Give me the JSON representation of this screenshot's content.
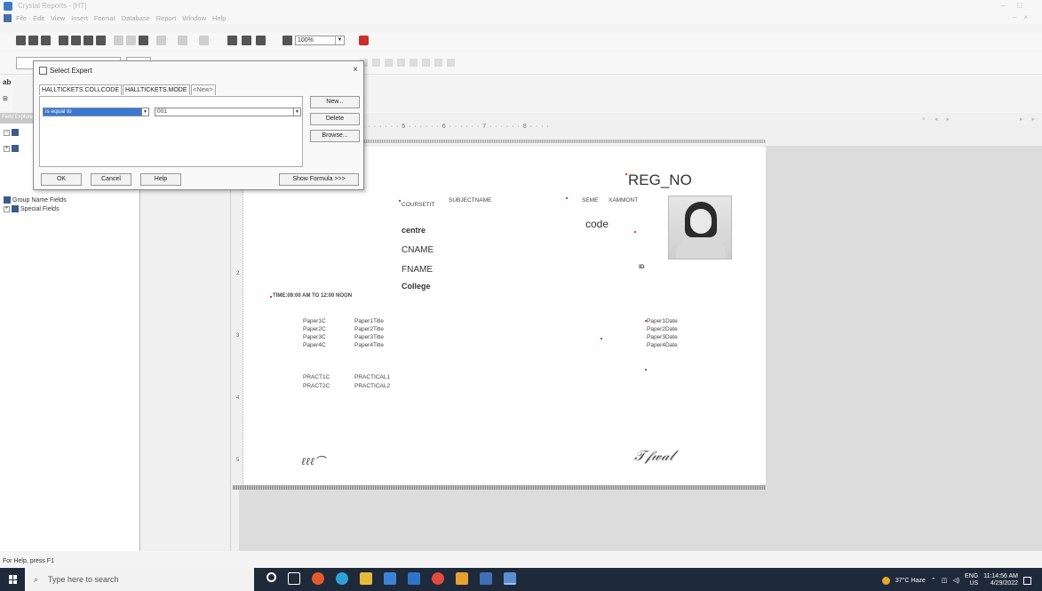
{
  "window": {
    "title": "Crystal Reports - [HT]"
  },
  "menu": [
    "File",
    "Edit",
    "View",
    "Insert",
    "Format",
    "Database",
    "Report",
    "Window",
    "Help"
  ],
  "toolbar": {
    "zoom": "100%"
  },
  "left_tools": {
    "text_tool": "ab"
  },
  "field_explorer": {
    "header": "Field Explorer",
    "items": [
      {
        "label": "Group Name Fields",
        "expand": ""
      },
      {
        "label": "Special Fields",
        "expand": "+"
      }
    ]
  },
  "dialog": {
    "title": "Select Expert",
    "close": "×",
    "tabs": [
      "HALLTICKETS.COLLCODE",
      "HALLTICKETS.MODE",
      "<New>"
    ],
    "operator": "is equal to",
    "value": "001",
    "buttons": {
      "new": "New...",
      "delete": "Delete",
      "browse": "Browse...",
      "ok": "OK",
      "cancel": "Cancel",
      "help": "Help",
      "show_formula": "Show Formula >>>"
    }
  },
  "report": {
    "reg_no": "REG_NO",
    "course": "COURSETIT",
    "subject": "SUBJECTNAME",
    "seme": "SEME",
    "exammonth": "XAMMONT",
    "code": "code",
    "centre": "centre",
    "cname": "CNAME",
    "fname": "FNAME",
    "college": "College",
    "time": "TIME:09:00 AM TO 12:00 NOON",
    "paper_codes": [
      "Paper1C",
      "Paper2C",
      "Paper3C",
      "Paper4C"
    ],
    "paper_titles": [
      "Paper1Title",
      "Paper2Title",
      "Paper3Title",
      "Paper4Title"
    ],
    "paper_dates": [
      "Paper1Date",
      "Paper2Date",
      "Paper3Date",
      "Paper4Date"
    ],
    "practical_codes": [
      "PRACT1C",
      "PRACT2C"
    ],
    "practical_titles": [
      "PRACTICAL1",
      "PRACTICAL2"
    ]
  },
  "status": {
    "help_text": "For Help, press F1"
  },
  "taskbar": {
    "search_placeholder": "Type here to search",
    "weather": "37°C Haze",
    "lang": "ENG",
    "region": "US",
    "time": "11:14:56 AM",
    "date": "4/29/2022"
  }
}
